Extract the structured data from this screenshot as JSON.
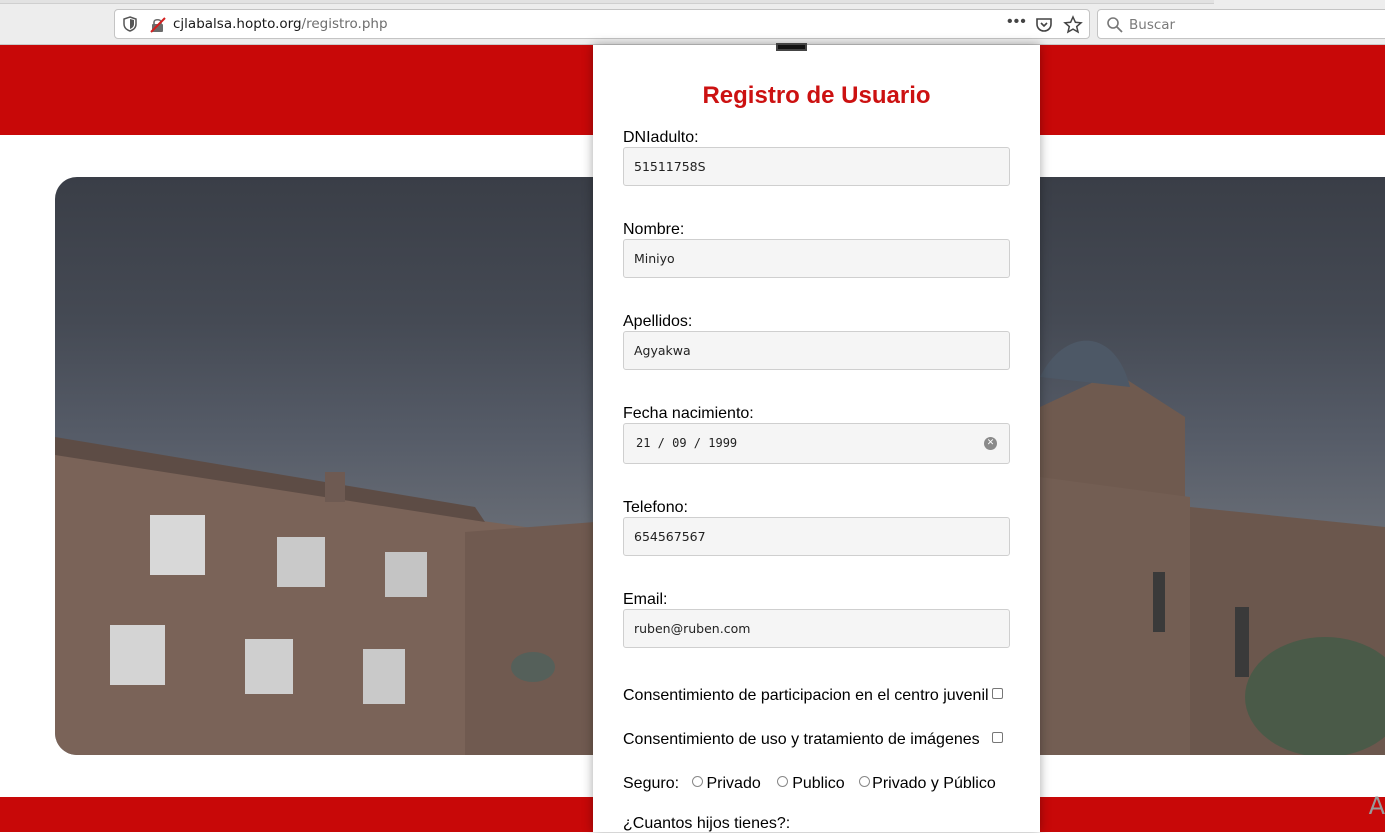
{
  "browser": {
    "url_host": "cjlabalsa.hopto.org",
    "url_path": "/registro.php",
    "more_menu": "•••",
    "search_placeholder": "Buscar"
  },
  "form": {
    "title": "Registro de Usuario",
    "fields": [
      {
        "label": "DNIadulto:",
        "value": "51511758S"
      },
      {
        "label": "Nombre:",
        "value": "Miniyo"
      },
      {
        "label": "Apellidos:",
        "value": "Agyakwa"
      },
      {
        "label": "Fecha nacimiento:",
        "value": "21 / 09 / 1999"
      },
      {
        "label": "Telefono:",
        "value": "654567567"
      },
      {
        "label": "Email:",
        "value": "ruben@ruben.com"
      }
    ],
    "consent_participation": "Consentimiento de participacion en el centro juvenil",
    "consent_images": "Consentimiento de uso y tratamiento de imágenes",
    "insurance": {
      "label": "Seguro:",
      "options": [
        "Privado",
        "Publico",
        "Privado y Público"
      ]
    },
    "children_question": "¿Cuantos hijos tienes?:"
  },
  "footer": {
    "partial_letter": "A"
  },
  "colors": {
    "brand_red": "#c80808",
    "title_red": "#cc1111"
  }
}
